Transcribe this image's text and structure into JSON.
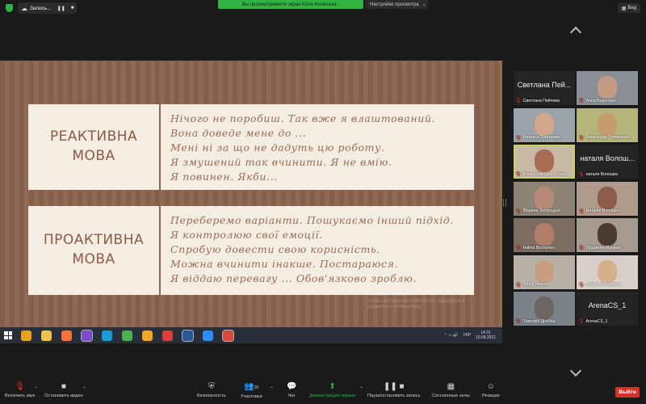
{
  "topbar": {
    "recording_label": "Запись...",
    "share_banner": "Вы просматриваете экран Юлія Копінська ·",
    "view_options": "Настройки просмотра",
    "view_button": "Вид"
  },
  "slide": {
    "reactive_title_1": "РЕАКТИВНА",
    "reactive_title_2": "МОВА",
    "reactive_lines": [
      "Нічого не поробиш. Так вже я влаштований.",
      "Вона доведе мене до ...",
      "Мені ні за що не дадуть цю роботу.",
      "Я змушений так вчинити. Я не вмію.",
      "Я повинен. Якби..."
    ],
    "proactive_title_1": "ПРОАКТИВНА",
    "proactive_title_2": "МОВА",
    "proactive_lines": [
      "Переберемо варіанти.  Пошукаємо інший підхід.",
      "Я контролюю свої емоції.",
      "Спробую довести свою корисність.",
      "Можна вчинити інакше.  Постараюся.",
      "Я віддаю перевагу ... Обов'язково зроблю."
    ],
    "watermark": [
      "Активация Windows",
      "Чтобы активировать Windows, перейдите в",
      "параметры компьютера."
    ]
  },
  "taskbar": {
    "lang": "УКР",
    "time": "14:31",
    "date": "10.08.2021",
    "apps": [
      {
        "icon": "chrome-icon",
        "color": "#e8a317"
      },
      {
        "icon": "file-explorer-icon",
        "color": "#f2c14e"
      },
      {
        "icon": "firefox-icon",
        "color": "#ff7139"
      },
      {
        "icon": "viber-icon",
        "color": "#7d4bc7"
      },
      {
        "icon": "skype-icon",
        "color": "#1c9ad6"
      },
      {
        "icon": "utorrent-icon",
        "color": "#4caf50"
      },
      {
        "icon": "google-app-icon",
        "color": "#f4a52a"
      },
      {
        "icon": "opera-icon",
        "color": "#e23b3b"
      },
      {
        "icon": "word-icon",
        "color": "#2b5797"
      },
      {
        "icon": "zoom-icon",
        "color": "#2d8cff"
      },
      {
        "icon": "pdf-app-icon",
        "color": "#d84a3a"
      }
    ]
  },
  "participants": [
    {
      "big": "Светлана Пей...",
      "caption": "Светлана Пейчева",
      "video": false
    },
    {
      "big": "",
      "caption": "Anna Bogovaya",
      "video": true,
      "bg": "#8a8f95",
      "face": "#c49b84"
    },
    {
      "big": "",
      "caption": "Наталья Зурнаджи",
      "video": true,
      "bg": "#9aa3a8",
      "face": "#d3a68b"
    },
    {
      "big": "",
      "caption": "Александр Глуминский",
      "video": true,
      "bg": "#b4b57a",
      "face": "#c79b6b"
    },
    {
      "big": "",
      "caption": "Юлія Копінська - Петр...",
      "video": true,
      "bg": "#c7b9a3",
      "face": "#a96b52",
      "active": true
    },
    {
      "big": "наталя Волош...",
      "caption": "наталя Волошко",
      "video": false
    },
    {
      "big": "",
      "caption": "Марина Загородня...",
      "video": true,
      "bg": "#8d8476",
      "face": "#b88b78"
    },
    {
      "big": "",
      "caption": "Наталія Волошко",
      "video": true,
      "bg": "#b09a8c",
      "face": "#8c5b4a"
    },
    {
      "big": "",
      "caption": "Halina Bozhenko",
      "video": true,
      "bg": "#7e6d63",
      "face": "#b07e68"
    },
    {
      "big": "",
      "caption": "Людмила Жуцман",
      "video": true,
      "bg": "#a59b90",
      "face": "#4a3a33"
    },
    {
      "big": "",
      "caption": "Tanya Nesvat",
      "video": true,
      "bg": "#b7b0a7",
      "face": "#c99d80"
    },
    {
      "big": "",
      "caption": "Вероніка Бабенко",
      "video": true,
      "bg": "#d8d0c8",
      "face": "#d5b08a"
    },
    {
      "big": "",
      "caption": "Тимофій Дробан",
      "video": true,
      "bg": "#7b8389",
      "face": "#6d655f"
    },
    {
      "big": "ArenaCS_1",
      "caption": "ArenaCS_1",
      "video": false
    }
  ],
  "toolbar": {
    "mute": "Включить звук",
    "video": "Остановить видео",
    "security": "Безопасность",
    "participants": "Участники",
    "participants_count": "20",
    "chat": "Чат",
    "share": "Демонстрация экрана",
    "record": "Пауза/остановить запись",
    "breakout": "Сессионные залы",
    "reactions": "Реакции",
    "leave": "Выйти"
  }
}
